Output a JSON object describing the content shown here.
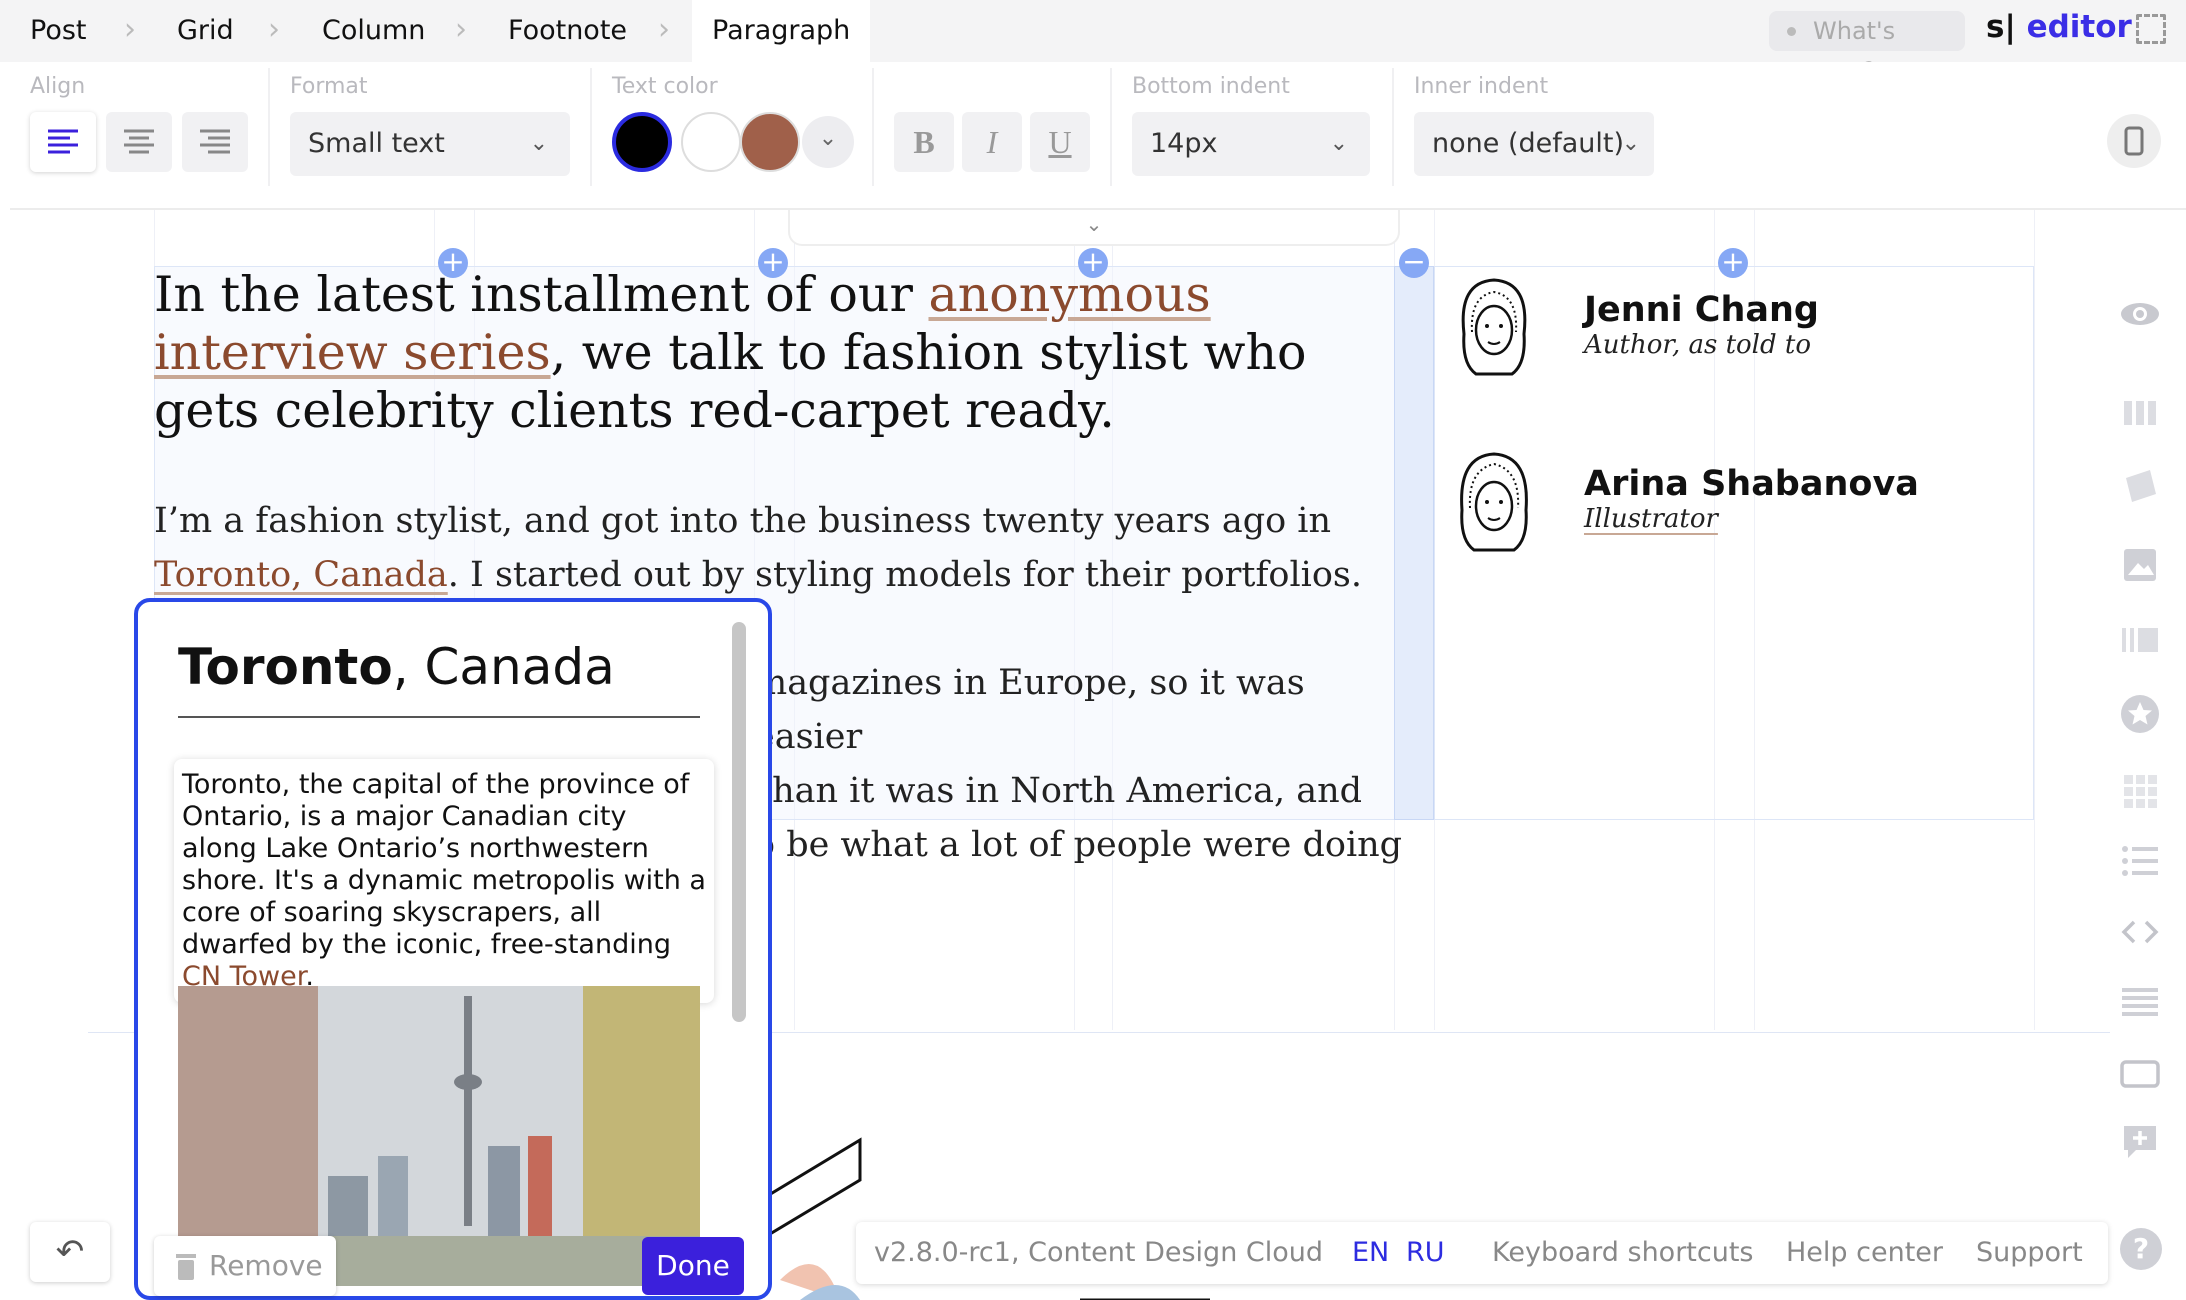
{
  "breadcrumb": [
    "Post",
    "Grid",
    "Column",
    "Footnote",
    "Paragraph"
  ],
  "whats_new": "What's new?",
  "logo": {
    "mark": "s|",
    "name": "editor"
  },
  "toolbar": {
    "align_label": "Align",
    "format_label": "Format",
    "format_value": "Small text",
    "color_label": "Text color",
    "colors": [
      "#000000",
      "#ffffff",
      "#a0604a"
    ],
    "bold": "B",
    "italic": "I",
    "underline": "U",
    "bottom_indent_label": "Bottom indent",
    "bottom_indent_value": "14px",
    "inner_indent_label": "Inner indent",
    "inner_indent_value": "none (default)"
  },
  "article": {
    "heading_pre": "In the latest installment of our ",
    "heading_link": "anonymous interview series",
    "heading_post": ", we talk to fashion stylist who gets celebrity clients red-carpet ready.",
    "body_line1": "I’m a fashion stylist, and got into the business twenty years ago in",
    "body_link": "Toronto, Canada",
    "body_line2": ". I started out by styling models for their portfolios. At the",
    "body_line3": "magazines in Europe, so it was easier",
    "body_line4": "than it was in North America, and",
    "body_line5": "o be what a lot of people were doing"
  },
  "authors": [
    {
      "name": "Jenni Chang",
      "role": "Author, as told to"
    },
    {
      "name": "Arina Shabanova",
      "role": "Illustrator"
    }
  ],
  "popover": {
    "title_bold": "Toronto",
    "title_rest": ", Canada",
    "desc": "Toronto, the capital of the province of Ontario, is a major Canadian city along Lake Ontario’s northwestern shore. It's a dynamic metropolis with a core of soaring skyscrapers, all dwarfed by the iconic, free-standing ",
    "desc_link": "CN Tower",
    "desc_end": ".",
    "remove": "Remove",
    "done": "Done"
  },
  "footer": {
    "version": "v2.8.0-rc1, Content Design Cloud",
    "lang_en": "EN",
    "lang_ru": "RU",
    "shortcuts": "Keyboard shortcuts",
    "help": "Help center",
    "support": "Support"
  },
  "colors": {
    "accent": "#3b20dc",
    "link": "#8b4a2e",
    "popover_border": "#2948e8"
  }
}
